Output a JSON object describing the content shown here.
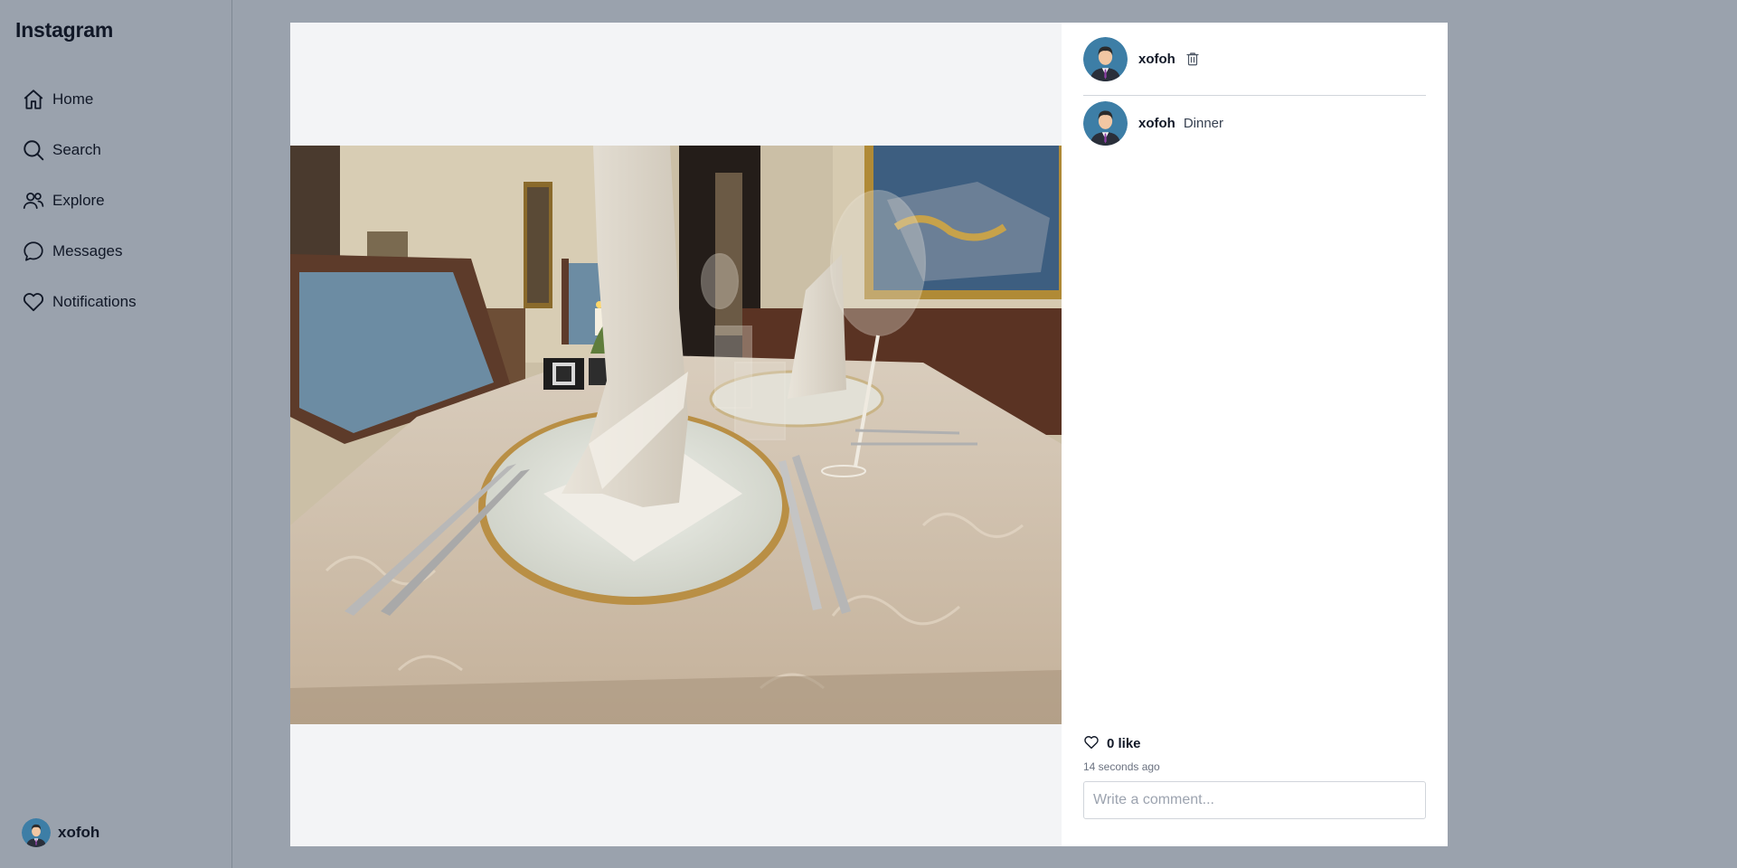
{
  "app": {
    "title": "Instagram"
  },
  "sidebar": {
    "items": [
      {
        "label": "Home",
        "icon": "home-icon"
      },
      {
        "label": "Search",
        "icon": "search-icon"
      },
      {
        "label": "Explore",
        "icon": "people-icon"
      },
      {
        "label": "Messages",
        "icon": "chat-icon"
      },
      {
        "label": "Notifications",
        "icon": "heart-icon"
      }
    ],
    "user": {
      "username": "xofoh"
    }
  },
  "post": {
    "author": "xofoh",
    "caption_author": "xofoh",
    "caption": "Dinner",
    "likes_label": "0 like",
    "timestamp": "14 seconds ago",
    "comment_placeholder": "Write a comment...",
    "image": "restaurant-table-setting-photo"
  },
  "colors": {
    "background": "#9aa2ad",
    "modal": "#ffffff",
    "media_background": "#f3f4f6"
  }
}
